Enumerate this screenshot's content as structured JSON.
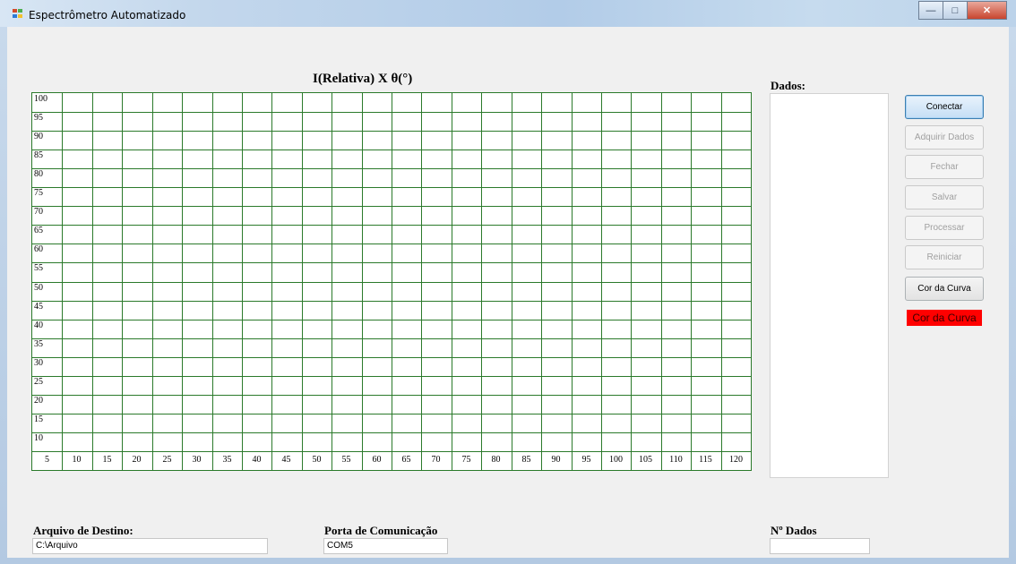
{
  "window": {
    "title": "Espectrômetro Automatizado"
  },
  "chart_data": {
    "type": "line",
    "title": "I(Relativa) X θ(°)",
    "xlabel": "",
    "ylabel": "",
    "xlim": [
      5,
      120
    ],
    "ylim": [
      10,
      100
    ],
    "x_ticks": [
      "5",
      "10",
      "15",
      "20",
      "25",
      "30",
      "35",
      "40",
      "45",
      "50",
      "55",
      "60",
      "65",
      "70",
      "75",
      "80",
      "85",
      "90",
      "95",
      "100",
      "105",
      "110",
      "115",
      "120"
    ],
    "y_ticks": [
      "100",
      "95",
      "90",
      "85",
      "80",
      "75",
      "70",
      "65",
      "60",
      "55",
      "50",
      "45",
      "40",
      "35",
      "30",
      "25",
      "20",
      "15",
      "10"
    ],
    "grid": true,
    "series": []
  },
  "data_panel": {
    "label": "Dados:"
  },
  "buttons": {
    "conectar": "Conectar",
    "adquirir": "Adquirir Dados",
    "fechar": "Fechar",
    "salvar": "Salvar",
    "processar": "Processar",
    "reiniciar": "Reiniciar",
    "cor_curva": "Cor da Curva"
  },
  "color_indicator": {
    "label": "Cor da Curva",
    "color": "#ff0000"
  },
  "fields": {
    "arquivo_label": "Arquivo de Destino:",
    "arquivo_value": "C:\\Arquivo",
    "porta_label": "Porta de Comunicação",
    "porta_value": "COM5",
    "ndados_label": "Nº Dados",
    "ndados_value": ""
  }
}
